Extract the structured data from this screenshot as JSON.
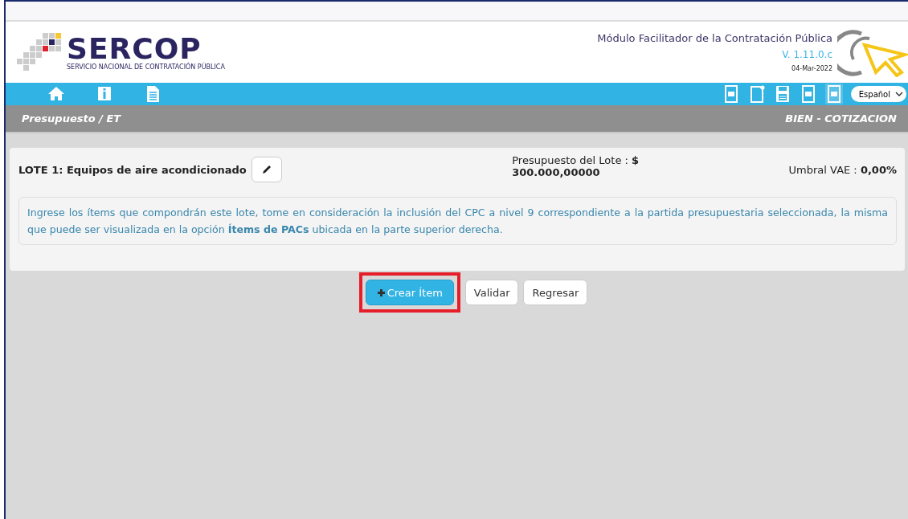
{
  "header": {
    "logo_text": "SERCOP",
    "logo_subtitle": "SERVICIO NACIONAL DE CONTRATACIÓN PÚBLICA",
    "module_title": "Módulo Facilitador de la Contratación Pública",
    "version": "V. 1.11.0.c",
    "date": "04-Mar-2022"
  },
  "toolbar": {
    "left_icons": [
      {
        "kind": "home"
      },
      {
        "kind": "info"
      },
      {
        "kind": "document"
      }
    ],
    "right_icons": [
      {
        "kind": "pdf",
        "selected": false
      },
      {
        "kind": "page",
        "selected": false
      },
      {
        "kind": "save",
        "selected": false
      },
      {
        "kind": "pdf",
        "selected": false
      },
      {
        "kind": "pdf",
        "selected": true
      }
    ],
    "language": "Español"
  },
  "breadcrumb": {
    "left": "Presupuesto / ET",
    "right": "BIEN - COTIZACION"
  },
  "lot": {
    "title": "LOTE 1: Equipos de aire acondicionado",
    "budget_label": "Presupuesto del Lote : **$**",
    "budget_value": "300.000,00000",
    "threshold": "Umbral VAE : **0,00%**",
    "info": "Ingrese los ítems que compondrán este lote, tome en consideración la inclusión del CPC a nivel 9 correspondiente a la partida presupuestaria seleccionada, la misma que puede ser visualizada en la opción **Ítems de PACs** ubicada en la parte superior derecha."
  },
  "buttons": [
    {
      "label": "Crear Ítem",
      "kind": "primary",
      "highlighted": true
    },
    {
      "label": "Validar",
      "kind": "default",
      "highlighted": false
    },
    {
      "label": "Regresar",
      "kind": "default",
      "highlighted": false
    }
  ]
}
